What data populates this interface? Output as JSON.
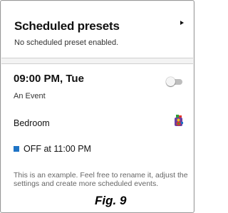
{
  "scheduled": {
    "title": "Scheduled presets",
    "subtitle": "No scheduled preset enabled.",
    "chevron_icon": "chevron-right-icon"
  },
  "event": {
    "time": "09:00 PM, Tue",
    "name": "An Event",
    "toggle_on": false,
    "room": "Bedroom",
    "room_icon": "colorful-speaker-icon",
    "status": "OFF at 11:00 PM",
    "status_color": "#1f74c6",
    "hint": "This is an example. Feel free to rename it, adjust the settings and create more scheduled events."
  },
  "figure_label": "Fig. 9"
}
